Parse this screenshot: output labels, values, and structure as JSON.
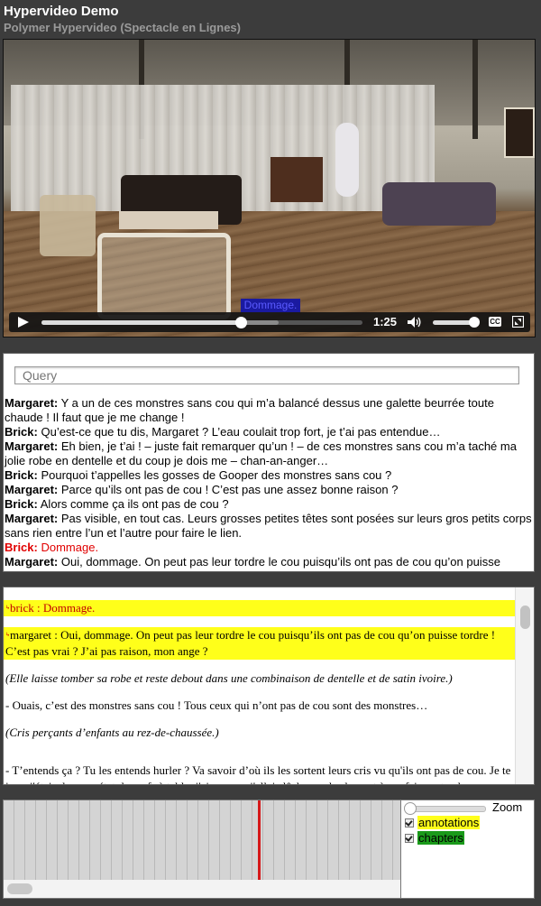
{
  "app": {
    "title": "Hypervideo Demo",
    "subtitle": "Polymer Hypervideo (Spectacle en Lignes)"
  },
  "video": {
    "caption": "Dommage.",
    "time": "1:25",
    "progress": 0.62,
    "buffered": 0.74,
    "volume": 0.95,
    "cc_label": "CC"
  },
  "transcript": {
    "query_placeholder": "Query",
    "current_index": 7,
    "lines": [
      {
        "speaker": "Margaret:",
        "text": " Y a un de ces monstres sans cou qui m’a balancé dessus une galette beurrée toute chaude ! Il faut que je me change !"
      },
      {
        "speaker": "Brick:",
        "text": " Qu’est-ce que tu dis, Margaret ? L’eau coulait trop fort, je t’ai pas entendue…"
      },
      {
        "speaker": "Margaret:",
        "text": " Eh bien, je t’ai ! – juste fait remarquer qu’un ! – de ces monstres sans cou m’a taché ma jolie robe en dentelle et du coup je dois me – chan-an-anger…"
      },
      {
        "speaker": "Brick:",
        "text": " Pourquoi t’appelles les gosses de Gooper des monstres sans cou ?"
      },
      {
        "speaker": "Margaret:",
        "text": " Parce qu’ils ont pas de cou ! C’est pas une assez bonne raison ?"
      },
      {
        "speaker": "Brick:",
        "text": " Alors comme ça ils ont pas de cou ?"
      },
      {
        "speaker": "Margaret:",
        "text": " Pas visible, en tout cas. Leurs grosses petites têtes sont posées sur leurs gros petits corps sans rien entre l’un et l’autre pour faire le lien."
      },
      {
        "speaker": "Brick:",
        "text": " Dommage."
      },
      {
        "speaker": "Margaret:",
        "text": " Oui, dommage. On peut pas leur tordre le cou puisqu’ils ont pas de cou qu’on puisse tordre ! C’est pas vrai ? J’ai pas raison, mon ange ?"
      }
    ]
  },
  "annotations": {
    "icon": "link-icon",
    "items": [
      {
        "type": "highlight",
        "current": true,
        "text": "brick : Dommage."
      },
      {
        "type": "highlight",
        "current": false,
        "text": "margaret : Oui, dommage. On peut pas leur tordre le cou puisqu’ils ont pas de cou qu’on puisse tordre ! C’est pas vrai ? J’ai pas raison, mon ange ?"
      },
      {
        "type": "stage",
        "text": "(Elle laisse tomber sa robe et reste debout dans une combinaison de dentelle et de satin ivoire.)"
      },
      {
        "type": "text",
        "text": "- Ouais, c’est des monstres sans cou ! Tous ceux qui n’ont pas de cou sont des monstres…"
      },
      {
        "type": "stage",
        "text": "(Cris perçants d’enfants au rez-de-chaussée.)"
      },
      {
        "type": "text",
        "text": "- T’entends ça ? Tu les entends hurler ? Va savoir d’où ils les sortent leurs cris vu qu'ils ont pas de cou. Je te jure, j'étais dans un état de nerfs à table, j'ai cru que j'allais lâcher un hurlement à me faire entendre"
      }
    ]
  },
  "timeline": {
    "playhead_position": 0.64,
    "playhead_color": "#d6191a"
  },
  "sidebar": {
    "zoom_label": "Zoom",
    "zoom_value": 0,
    "layers": [
      {
        "label": "annotations",
        "color": "#ffff1a",
        "text_color": "#000000",
        "checked": true
      },
      {
        "label": "chapters",
        "color": "#1a9a1a",
        "text_color": "#000000",
        "checked": true
      }
    ]
  },
  "colors": {
    "highlight": "#ffff1a",
    "current_line": "#e10000",
    "caption_bg": "#1a1aa0",
    "caption_text": "#5a5aff"
  }
}
